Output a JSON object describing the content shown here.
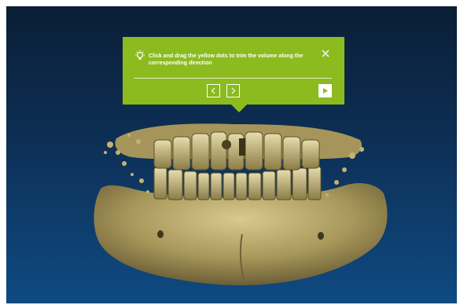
{
  "tour_tip": {
    "text": "Click and drag the yellow dots to trim the volume along the corresponding direction",
    "icons": {
      "tip": "lightbulb-icon",
      "close": "close-icon",
      "previous": "chevron-left-icon",
      "next": "chevron-right-icon",
      "play": "play-icon"
    },
    "colors": {
      "popup": "#8bbb1e",
      "text": "#ffffff"
    }
  },
  "viewport": {
    "colors": {
      "background_top": "#0a1e36",
      "background_bottom": "#0f4a82",
      "bone": "#b8a76a"
    }
  }
}
